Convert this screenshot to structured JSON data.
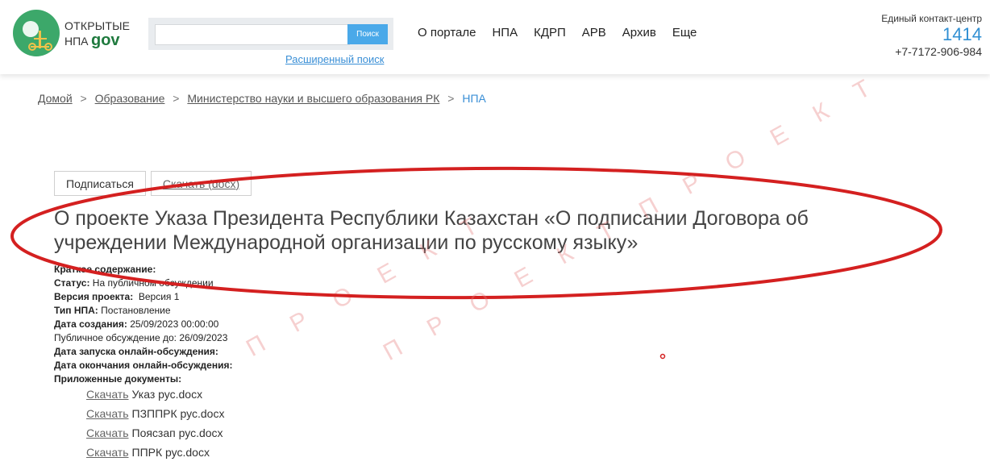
{
  "header": {
    "logo": {
      "line1": "ОТКРЫТЫЕ",
      "line2": "НПА",
      "gov": "gov"
    },
    "search": {
      "value": "",
      "placeholder": "",
      "button": "Поиск",
      "advanced": "Расширенный поиск"
    },
    "nav": [
      "О портале",
      "НПА",
      "КДРП",
      "АРВ",
      "Архив",
      "Еще"
    ],
    "contact": {
      "label": "Единый контакт-центр",
      "number": "1414",
      "phone": "+7-7172-906-984"
    }
  },
  "breadcrumb": {
    "items": [
      "Домой",
      "Образование",
      "Министерство науки и высшего образования РК"
    ],
    "current": "НПА",
    "separator": ">"
  },
  "actions": {
    "subscribe": "Подписаться",
    "download": "Скачать (docx)"
  },
  "title": "О проекте Указа Президента Республики Казахстан «О подписании Договора об учреждении Международной организации по русскому языку»",
  "details": [
    {
      "label": "Краткое содержание:",
      "value": ""
    },
    {
      "label": "Статус:",
      "value": "На публичном обсуждении"
    },
    {
      "label": "Версия проекта:",
      "value": "Версия 1"
    },
    {
      "label": "Тип НПА:",
      "value": "Постановление"
    },
    {
      "label": "Дата создания:",
      "value": "25/09/2023 00:00:00"
    },
    {
      "label": "Публичное обсуждение до:",
      "value": "26/09/2023"
    },
    {
      "label": "Дата запуска онлайн-обсуждения:",
      "value": ""
    },
    {
      "label": "Дата окончания онлайн-обсуждения:",
      "value": ""
    },
    {
      "label": "Приложенные документы:",
      "value": ""
    }
  ],
  "files": [
    {
      "link": "Скачать",
      "name": "Указ рус.docx"
    },
    {
      "link": "Скачать",
      "name": "ПЗППРК рус.docx"
    },
    {
      "link": "Скачать",
      "name": "Поясзап рус.docx"
    },
    {
      "link": "Скачать",
      "name": "ППРК рус.docx"
    }
  ],
  "watermark": {
    "text1": "П Р О Е К Т",
    "text2": "П Р О Е К Т   П Р О Е К Т"
  },
  "colors": {
    "accent": "#2f8fd3",
    "logo": "#3ca86a",
    "annotation": "#d42020"
  }
}
